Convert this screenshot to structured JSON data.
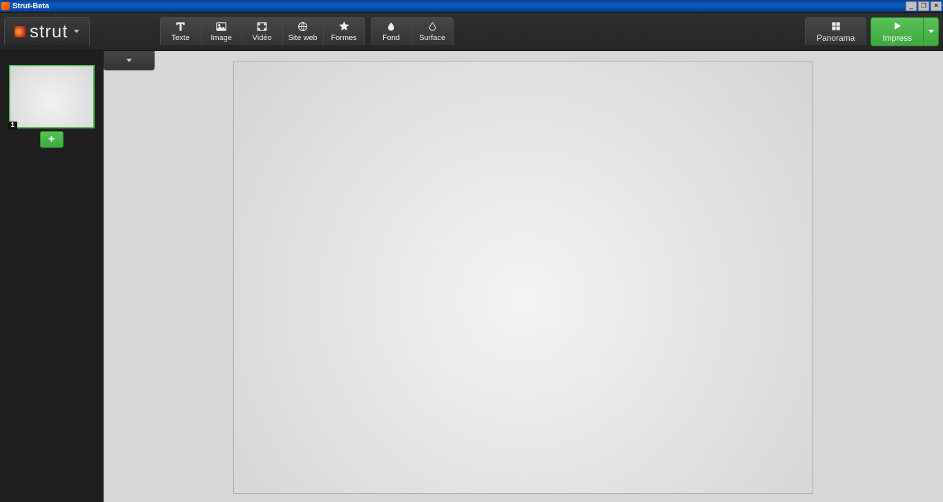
{
  "window": {
    "title": "Strut-Beta"
  },
  "logo": {
    "text": "strut"
  },
  "tools": {
    "text": {
      "label": "Texte",
      "icon": "text"
    },
    "image": {
      "label": "Image",
      "icon": "image"
    },
    "video": {
      "label": "Vidéo",
      "icon": "video"
    },
    "web": {
      "label": "Site web",
      "icon": "globe"
    },
    "shapes": {
      "label": "Formes",
      "icon": "star"
    }
  },
  "style_tools": {
    "background": {
      "label": "Fond",
      "icon": "drop"
    },
    "surface": {
      "label": "Surface",
      "icon": "drop"
    }
  },
  "actions": {
    "panorama": {
      "label": "Panorama",
      "icon": "grid"
    },
    "impress": {
      "label": "Impress",
      "icon": "play"
    }
  },
  "slides": [
    {
      "number": "1"
    }
  ],
  "add_slide_label": "+"
}
